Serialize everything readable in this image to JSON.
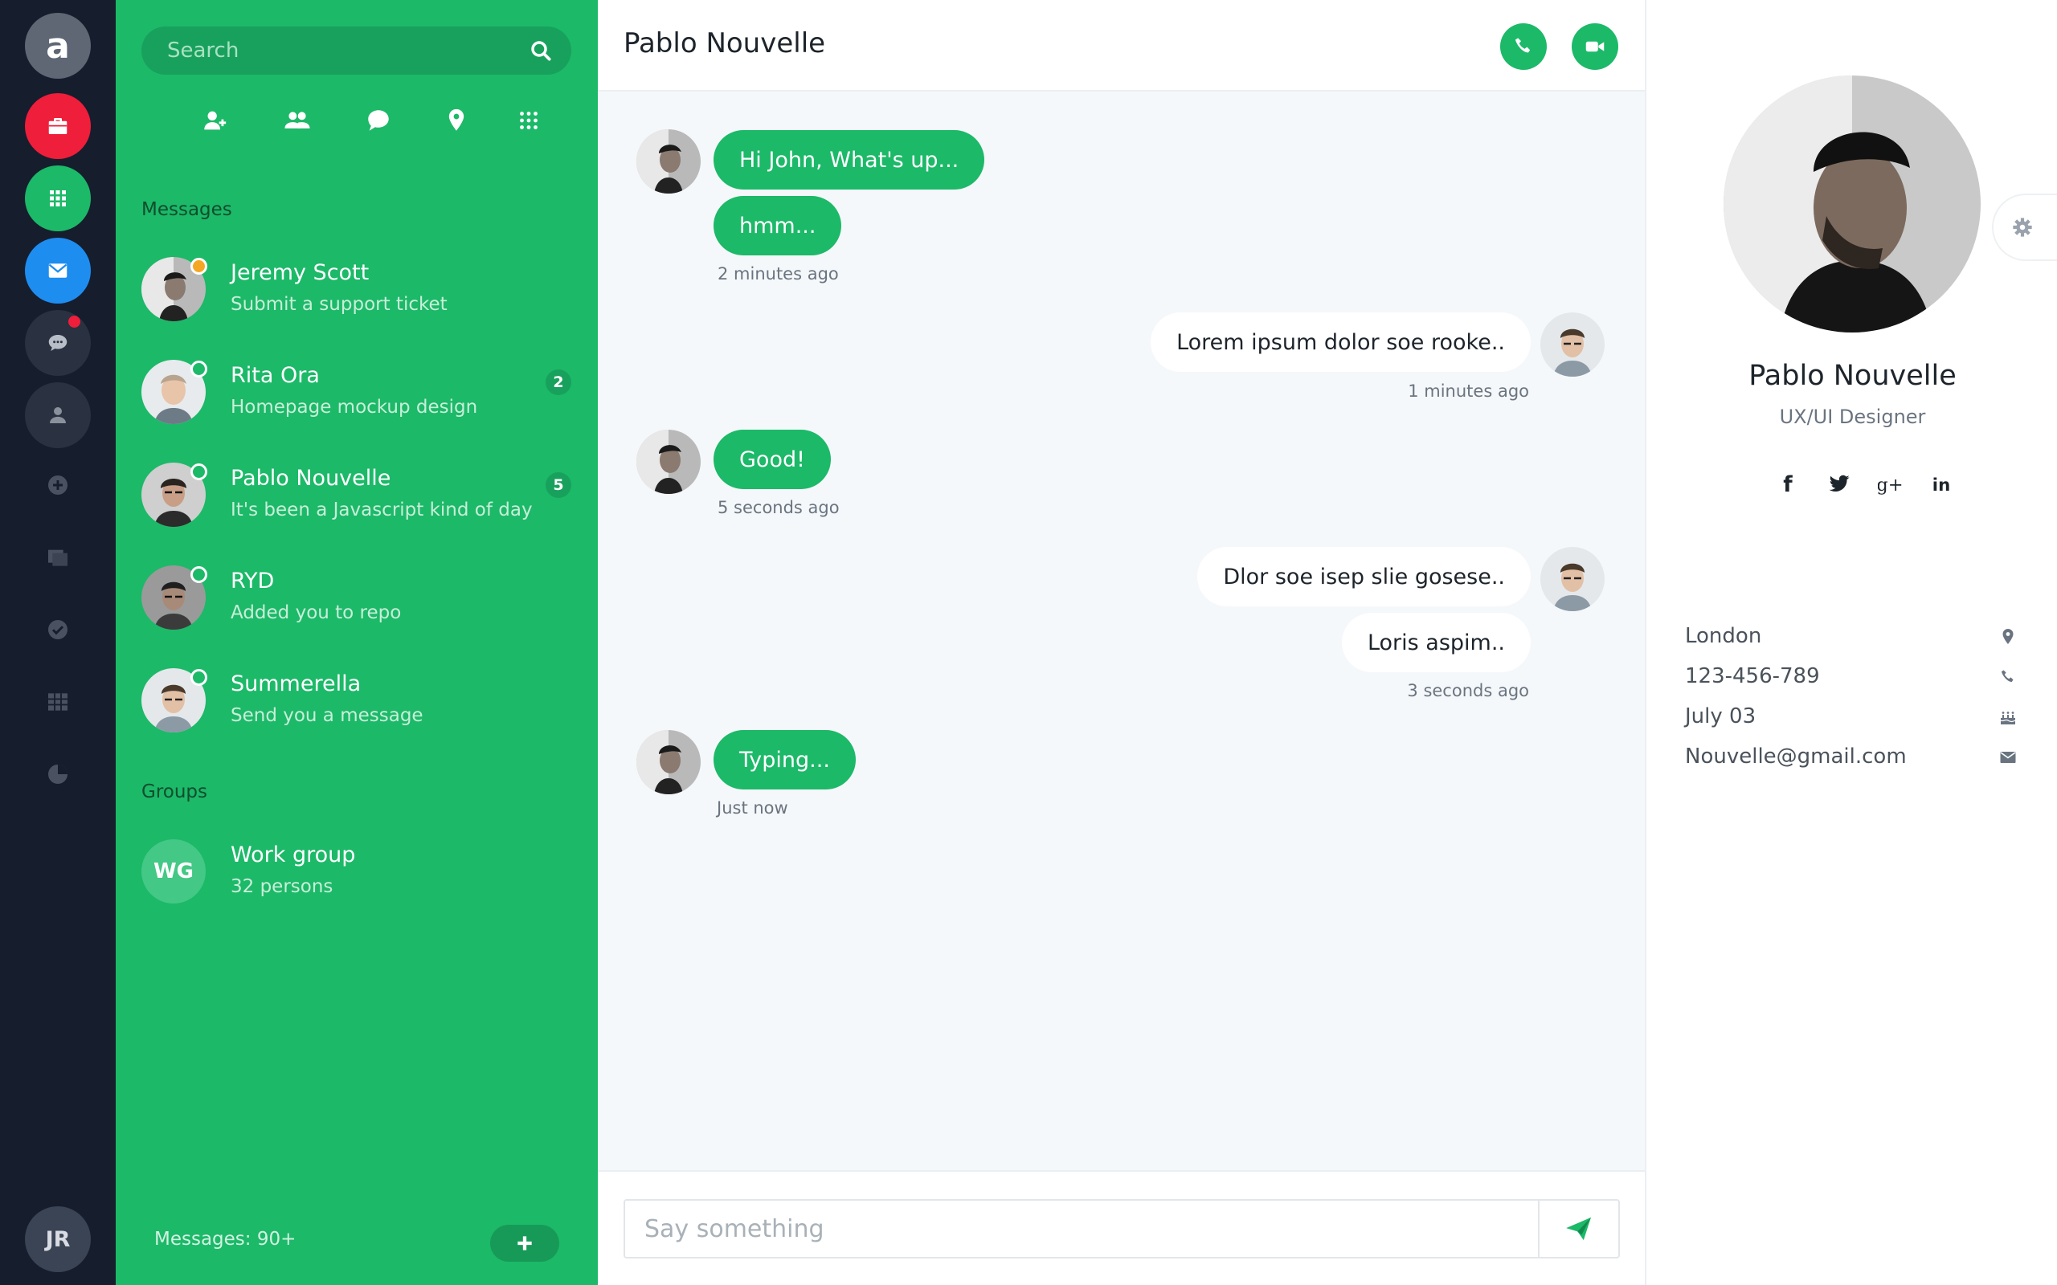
{
  "app": {
    "logo_letter": "a"
  },
  "rail": {
    "items": [
      {
        "icon": "briefcase-icon",
        "color": "#ef1e3a"
      },
      {
        "icon": "apps-grid-icon",
        "color": "#1cb968"
      },
      {
        "icon": "mail-icon",
        "color": "#1e8df0"
      },
      {
        "icon": "chat-icon",
        "color": "#2a3140",
        "has_notification": true
      },
      {
        "icon": "user-icon",
        "color": "#2a3140"
      },
      {
        "icon": "plus-circle-icon"
      },
      {
        "icon": "copy-icon"
      },
      {
        "icon": "check-circle-icon"
      },
      {
        "icon": "table-icon"
      },
      {
        "icon": "pie-chart-icon"
      }
    ],
    "user_initials": "JR"
  },
  "sidebar": {
    "search_placeholder": "Search",
    "tools": [
      "add-contact-icon",
      "users-icon",
      "chat-bubble-icon",
      "location-pin-icon",
      "apps-icon"
    ],
    "messages_title": "Messages",
    "contacts": [
      {
        "name": "Jeremy Scott",
        "preview": "Submit a support ticket",
        "status_color": "#f5a623",
        "badge": null
      },
      {
        "name": "Rita Ora",
        "preview": "Homepage mockup design",
        "status_color": "#1cb968",
        "badge": "2"
      },
      {
        "name": "Pablo Nouvelle",
        "preview": "It's been a Javascript kind of day",
        "status_color": "#1cb968",
        "badge": "5"
      },
      {
        "name": "RYD",
        "preview": "Added you to repo",
        "status_color": "#1cb968",
        "badge": null
      },
      {
        "name": "Summerella",
        "preview": "Send you a message",
        "status_color": "#1cb968",
        "badge": null
      }
    ],
    "groups_title": "Groups",
    "groups": [
      {
        "initials": "WG",
        "name": "Work group",
        "preview": "32 persons"
      }
    ],
    "footer_text": "Messages: 90+",
    "add_label": "+"
  },
  "chat": {
    "title": "Pablo Nouvelle",
    "actions": [
      "phone-icon",
      "video-icon"
    ],
    "messages": [
      {
        "from": "them",
        "text": "Hi John, What's up..."
      },
      {
        "from": "them",
        "text": "hmm..."
      },
      {
        "from": "them",
        "time": "2 minutes ago"
      },
      {
        "from": "me",
        "text": "Lorem ipsum dolor soe rooke.."
      },
      {
        "from": "me",
        "time": "1 minutes ago"
      },
      {
        "from": "them",
        "text": "Good!"
      },
      {
        "from": "them",
        "time": "5 seconds ago"
      },
      {
        "from": "me",
        "text": "Dlor soe isep slie gosese.."
      },
      {
        "from": "me",
        "text": "Loris aspim.."
      },
      {
        "from": "me",
        "time": "3 seconds ago"
      },
      {
        "from": "them",
        "text": "Typing..."
      },
      {
        "from": "them",
        "time": "Just now"
      }
    ],
    "composer_placeholder": "Say something",
    "send_icon": "send-icon"
  },
  "profile": {
    "name": "Pablo Nouvelle",
    "role": "UX/UI Designer",
    "social": [
      "facebook-icon",
      "twitter-icon",
      "google-plus-icon",
      "linkedin-icon"
    ],
    "social_labels": {
      "facebook": "f",
      "google": "g+",
      "linkedin": "in"
    },
    "details": [
      {
        "text": "London",
        "icon": "location-pin-icon"
      },
      {
        "text": "123-456-789",
        "icon": "phone-icon"
      },
      {
        "text": "July 03",
        "icon": "birthday-cake-icon"
      },
      {
        "text": "Nouvelle@gmail.com",
        "icon": "envelope-icon"
      }
    ],
    "settings_icon": "gear-icon"
  },
  "colors": {
    "rail_bg": "#161d2d",
    "panel_green": "#1cb968",
    "accent_red": "#ef1e3a",
    "accent_blue": "#1e8df0",
    "chat_bg": "#f5f8fa"
  }
}
